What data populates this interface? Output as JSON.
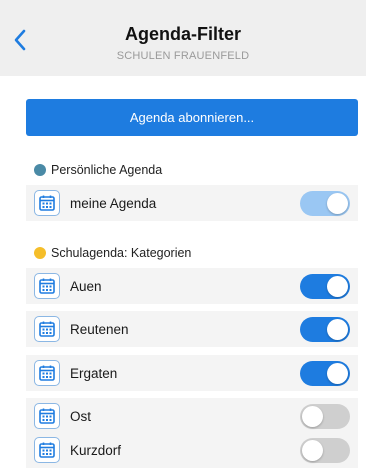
{
  "header": {
    "title": "Agenda-Filter",
    "subtitle": "SCHULEN FRAUENFELD",
    "back_icon": "chevron-left-icon"
  },
  "subscribe_label": "Agenda abonnieren...",
  "colors": {
    "accent": "#1e7ce0",
    "toggle_on": "#1e7ce0",
    "toggle_on_light": "#9ac7f3",
    "toggle_off": "#cfcfcf",
    "personal_dot": "#4a8aa6",
    "school_dot": "#f5be2a"
  },
  "sections": [
    {
      "title": "Persönliche Agenda",
      "items": [
        {
          "label": "meine Agenda",
          "enabled": true,
          "icon": "calendar-icon"
        }
      ]
    },
    {
      "title": "Schulagenda: Kategorien",
      "items": [
        {
          "label": "Auen",
          "enabled": true,
          "icon": "calendar-icon"
        },
        {
          "label": "Reutenen",
          "enabled": true,
          "icon": "calendar-icon"
        },
        {
          "label": "Ergaten",
          "enabled": true,
          "icon": "calendar-icon"
        },
        {
          "label": "Ost",
          "enabled": false,
          "icon": "calendar-icon"
        },
        {
          "label": "Kurzdorf",
          "enabled": false,
          "icon": "calendar-icon"
        }
      ]
    }
  ]
}
